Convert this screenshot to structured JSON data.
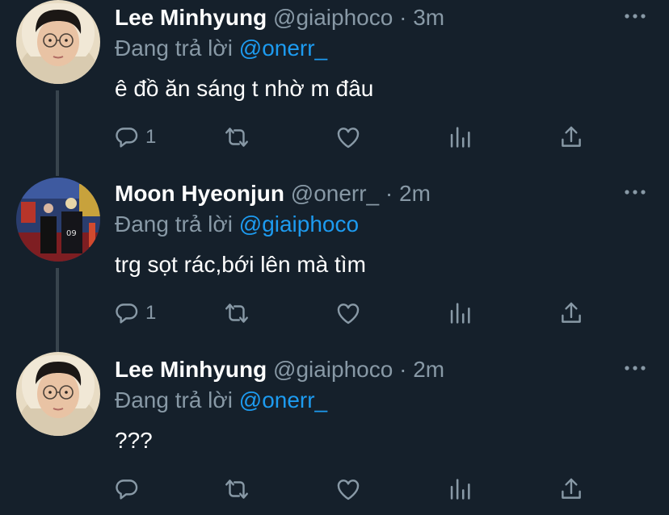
{
  "reply_prefix": "Đang trả lời",
  "separator": "·",
  "colors": {
    "background": "#15202b",
    "secondary_text": "#8899a6",
    "accent": "#1d9bf0",
    "thread_line": "#38444d"
  },
  "icons": [
    "reply-icon",
    "retweet-icon",
    "like-icon",
    "stats-icon",
    "share-icon",
    "more-icon"
  ],
  "tweets": [
    {
      "display_name": "Lee Minhyung",
      "handle": "@giaiphoco",
      "time": "3m",
      "reply_to": "@onerr_",
      "text": "ê đồ ăn sáng t nhờ m đâu",
      "reply_count": "1"
    },
    {
      "display_name": "Moon Hyeonjun",
      "handle": "@onerr_",
      "time": "2m",
      "reply_to": "@giaiphoco",
      "text": "trg sọt rác,bới lên mà tìm",
      "reply_count": "1"
    },
    {
      "display_name": "Lee Minhyung",
      "handle": "@giaiphoco",
      "time": "2m",
      "reply_to": "@onerr_",
      "text": "???",
      "reply_count": ""
    }
  ]
}
